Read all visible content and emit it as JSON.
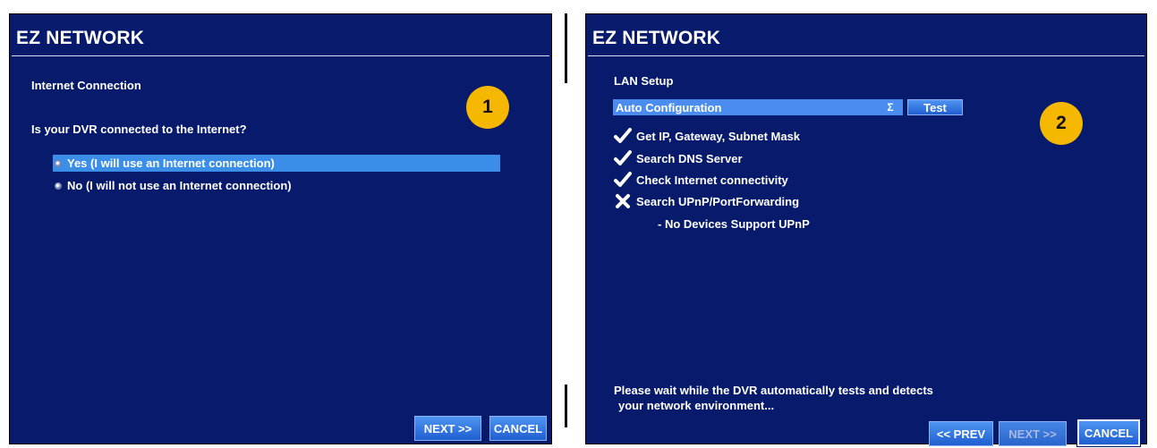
{
  "panel1": {
    "title": "EZ NETWORK",
    "badge": "1",
    "section_label": "Internet Connection",
    "question": "Is your DVR connected to the Internet?",
    "options": [
      {
        "label": "Yes (I will use an Internet connection)",
        "selected": true
      },
      {
        "label": "No (I will not use an Internet connection)",
        "selected": false
      }
    ],
    "buttons": {
      "next": "NEXT >>",
      "cancel": "CANCEL"
    }
  },
  "panel2": {
    "title": "EZ NETWORK",
    "badge": "2",
    "section_label": "LAN Setup",
    "mode_select": {
      "value": "Auto Configuration"
    },
    "test_button": "Test",
    "steps": [
      {
        "label": "Get IP, Gateway, Subnet Mask",
        "status": "check-icon"
      },
      {
        "label": "Search DNS Server",
        "status": "check-icon"
      },
      {
        "label": "Check Internet connectivity",
        "status": "check-icon"
      },
      {
        "label": "Search UPnP/PortForwarding",
        "status": "cross-icon"
      }
    ],
    "step_note": "- No Devices Support UPnP",
    "message_line1": "Please wait while the DVR automatically tests and detects",
    "message_line2": "your network environment...",
    "buttons": {
      "prev": "<< PREV",
      "next": "NEXT >>",
      "cancel": "CANCEL"
    }
  },
  "colors": {
    "panel_bg": "#071a6b",
    "selection": "#3a8ee8",
    "badge": "#f5b700"
  }
}
